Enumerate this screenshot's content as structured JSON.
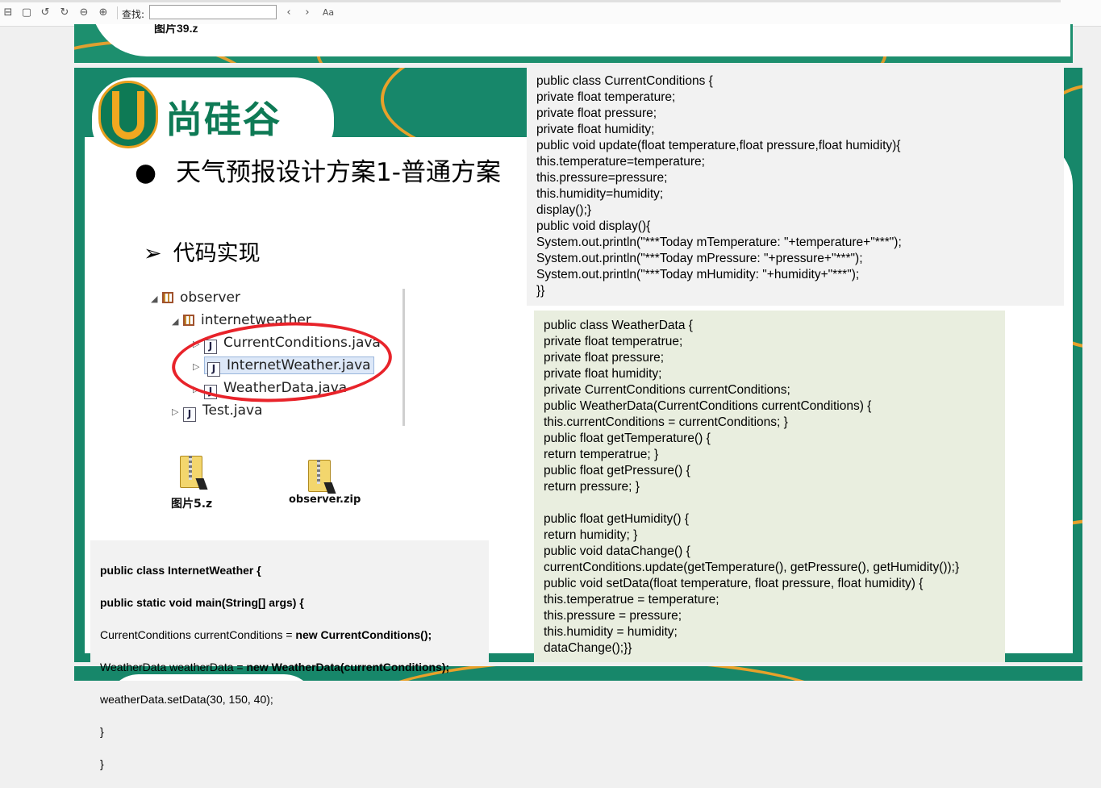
{
  "toolbar": {
    "find_label": "查找:",
    "find_value": "",
    "icons": [
      "layout-icon",
      "page-icon",
      "rotate-left-icon",
      "rotate-right-icon",
      "zoom-out-icon",
      "zoom-in-icon",
      "prev-icon",
      "next-icon",
      "match-case-icon"
    ],
    "match_case_glyph": "Aa"
  },
  "slide_top": {
    "caption": "图片39.z"
  },
  "slide_main": {
    "logo_text": "尚硅谷",
    "heading_bullet": "●",
    "heading": "天气预报设计方案1-普通方案",
    "subhead_bullet": "➢",
    "subhead": "代码实现",
    "tree": {
      "root": "observer",
      "package": "internetweather",
      "files": [
        "CurrentConditions.java",
        "InternetWeather.java",
        "WeatherData.java"
      ],
      "test_file": "Test.java"
    },
    "zip1_label": "图片5.z",
    "zip2_label": "observer.zip"
  },
  "code_current_conditions": "public class CurrentConditions {\nprivate float temperature;\nprivate float pressure;\nprivate float humidity;\npublic void update(float temperature,float pressure,float humidity){\nthis.temperature=temperature;\nthis.pressure=pressure;\nthis.humidity=humidity;\ndisplay();}\npublic void display(){\nSystem.out.println(\"***Today mTemperature: \"+temperature+\"***\");\nSystem.out.println(\"***Today mPressure: \"+pressure+\"***\");\nSystem.out.println(\"***Today mHumidity: \"+humidity+\"***\");\n}}",
  "code_weather_data": "public class WeatherData {\nprivate float temperatrue;\nprivate float pressure;\nprivate float humidity;\nprivate CurrentConditions currentConditions;\npublic WeatherData(CurrentConditions currentConditions) {\nthis.currentConditions = currentConditions; }\npublic float getTemperature() {\nreturn temperatrue; }\npublic float getPressure() {\nreturn pressure; }\n\npublic float getHumidity() {\nreturn humidity; }\npublic void dataChange() {\ncurrentConditions.update(getTemperature(), getPressure(), getHumidity());}\npublic void setData(float temperature, float pressure, float humidity) {\nthis.temperatrue = temperature;\nthis.pressure = pressure;\nthis.humidity = humidity;\ndataChange();}}",
  "code_internet_weather": {
    "line1": "public class InternetWeather {",
    "line2": "public static void main(String[] args) {",
    "line3_plain": "CurrentConditions currentConditions = ",
    "line3_bold": "new CurrentConditions();",
    "line4_plain": "WeatherData weatherData = ",
    "line4_bold": "new WeatherData(currentConditions);",
    "line5": "weatherData.setData(30, 150, 40);",
    "line6": "}",
    "line7": "}"
  }
}
